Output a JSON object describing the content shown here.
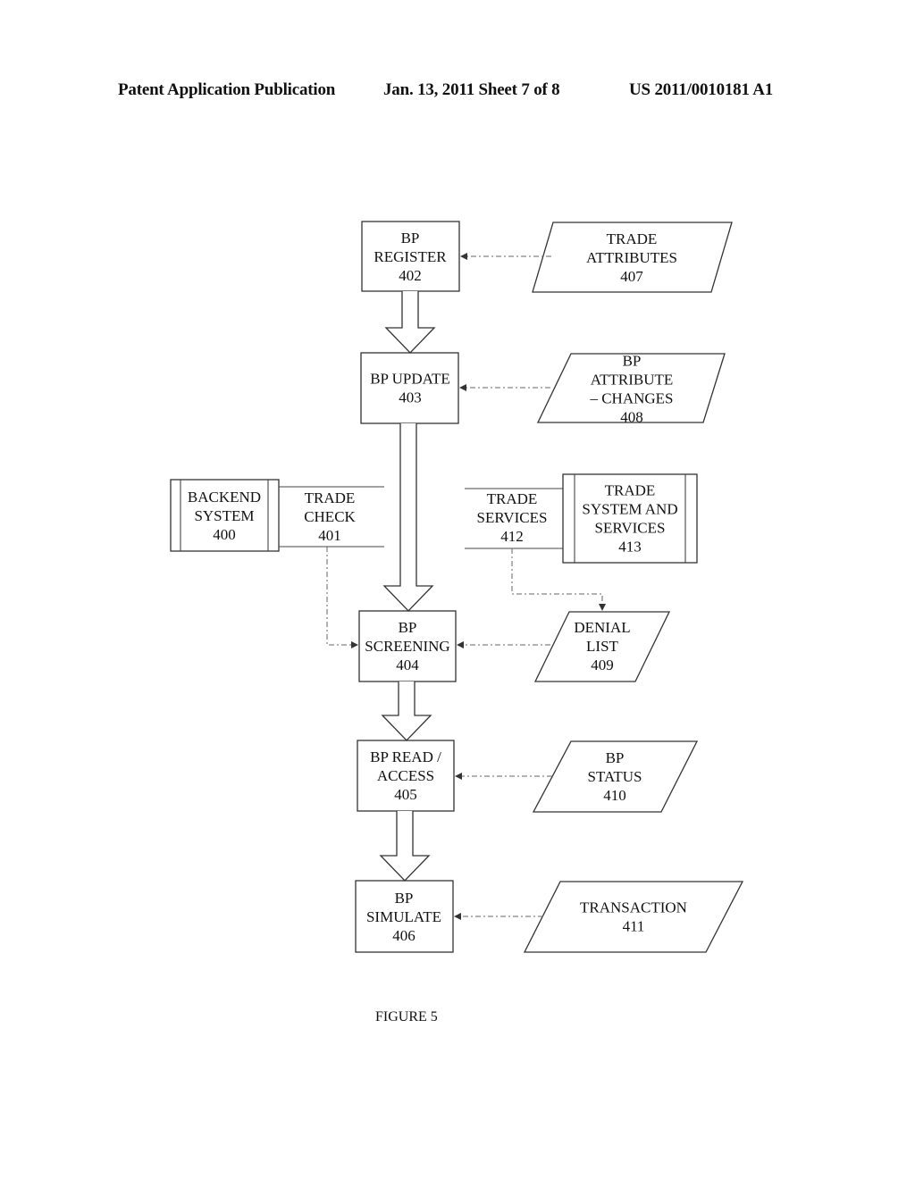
{
  "header": {
    "left": "Patent Application Publication",
    "center": "Jan. 13, 2011  Sheet 7 of 8",
    "right": "US 2011/0010181 A1"
  },
  "figure_caption": "FIGURE 5",
  "nodes": {
    "bp_register": {
      "lines": [
        "BP",
        "REGISTER",
        "402"
      ]
    },
    "bp_update": {
      "lines": [
        "BP UPDATE",
        "403"
      ]
    },
    "bp_screening": {
      "lines": [
        "BP",
        "SCREENING",
        "404"
      ]
    },
    "bp_read_access": {
      "lines": [
        "BP READ /",
        "ACCESS",
        "405"
      ]
    },
    "bp_simulate": {
      "lines": [
        "BP",
        "SIMULATE",
        "406"
      ]
    },
    "trade_attributes": {
      "lines": [
        "TRADE",
        "ATTRIBUTES",
        "407"
      ]
    },
    "bp_attribute_changes": {
      "lines": [
        "BP",
        "ATTRIBUTE",
        "– CHANGES",
        "408"
      ]
    },
    "denial_list": {
      "lines": [
        "DENIAL",
        "LIST",
        "409"
      ]
    },
    "bp_status": {
      "lines": [
        "BP",
        "STATUS",
        "410"
      ]
    },
    "transaction": {
      "lines": [
        "TRANSACTION",
        "411"
      ]
    },
    "backend_system": {
      "lines": [
        "BACKEND",
        "SYSTEM",
        "400"
      ]
    },
    "trade_check": {
      "lines": [
        "TRADE",
        "CHECK",
        "401"
      ]
    },
    "trade_services": {
      "lines": [
        "TRADE",
        "SERVICES",
        "412"
      ]
    },
    "trade_system_services": {
      "lines": [
        "TRADE",
        "SYSTEM AND",
        "SERVICES",
        "413"
      ]
    }
  }
}
